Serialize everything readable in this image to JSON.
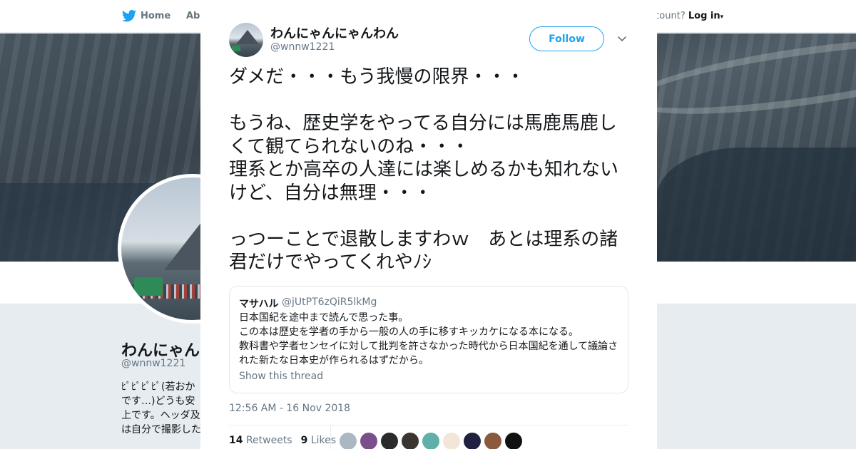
{
  "nav": {
    "home_label": "Home",
    "about_label": "Abo",
    "account_prompt": "ccount?",
    "login_label": "Log in"
  },
  "profile": {
    "name": "わんにゃん",
    "handle": "@wnnw1221",
    "bio_text": "ﾋﾟﾋﾟﾋﾟﾋﾟ(若おか\nです…)どうも安\n上です。ヘッダ及\nは自分で撮影した"
  },
  "tweet": {
    "author_name": "わんにゃんにゃんわん",
    "author_handle": "@wnnw1221",
    "follow_label": "Follow",
    "text": "ダメだ・・・もう我慢の限界・・・\n\nもうね、歴史学をやってる自分には馬鹿馬鹿しくて観てられないのね・・・\n理系とか高卒の人達には楽しめるかも知れないけど、自分は無理・・・\n\nっつーことで退散しますわｗ　あとは理系の諸君だけでやってくれやﾉｼ",
    "quoted": {
      "name": "マサハル",
      "handle": "@jUtPT6zQiR5lkMg",
      "text": "日本国紀を途中まで読んで思った事。\nこの本は歴史を学者の手から一般の人の手に移すキッカケになる本になる。\n教科書や学者センセイに対して批判を許さなかった時代から日本国紀を通して議論された新たな日本史が作られるはずだから。",
      "show_thread_label": "Show this thread"
    },
    "timestamp": "12:56 AM - 16 Nov 2018",
    "retweets_count": "14",
    "retweets_label": "Retweets",
    "likes_count": "9",
    "likes_label": "Likes"
  },
  "likers": [
    {
      "color": "#aab8c2"
    },
    {
      "color": "#7b4f8a"
    },
    {
      "color": "#2b2b2b"
    },
    {
      "color": "#3a3530"
    },
    {
      "color": "#5fb0a8"
    },
    {
      "color": "#f2e6d8"
    },
    {
      "color": "#202040"
    },
    {
      "color": "#8b5a3c"
    },
    {
      "color": "#111111"
    }
  ],
  "icons": [
    "twitter-bird-icon",
    "close-icon",
    "chevron-down-icon"
  ],
  "colors": {
    "accent": "#1da1f2",
    "text": "#14171a",
    "muted": "#657786"
  }
}
